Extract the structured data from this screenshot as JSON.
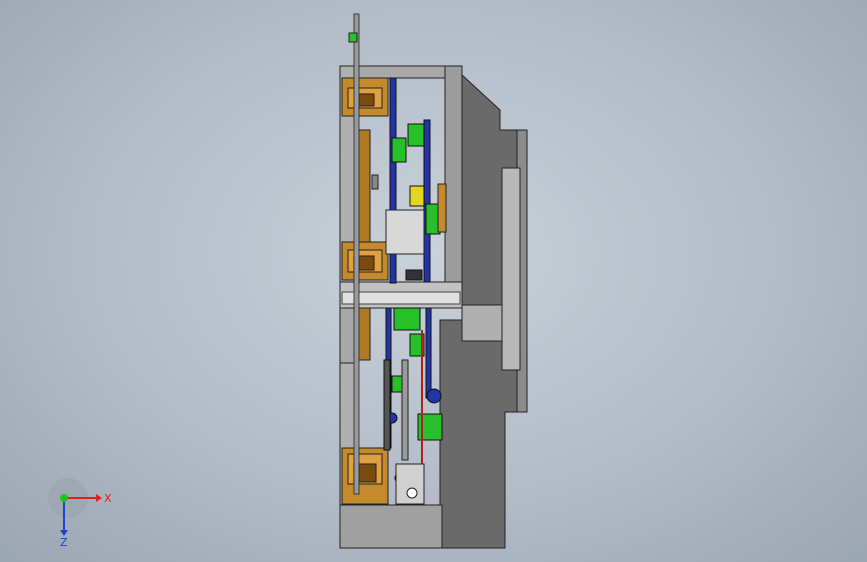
{
  "viewport": {
    "background_top": "#c9d1da",
    "background_bottom": "#9ba6b3"
  },
  "triad": {
    "x_label": "X",
    "z_label": "Z",
    "x_color": "#e02020",
    "y_color": "#20c020",
    "z_color": "#2040d0"
  },
  "model": {
    "colors": {
      "frame_gray": "#a9a9a9",
      "dark_gray": "#6c6c6c",
      "light_gray": "#d4d4d4",
      "orange": "#c88a2a",
      "orange_dark": "#8a5a14",
      "blue": "#2030a0",
      "green": "#27c027",
      "yellow": "#e0d020",
      "red": "#b02020"
    }
  }
}
